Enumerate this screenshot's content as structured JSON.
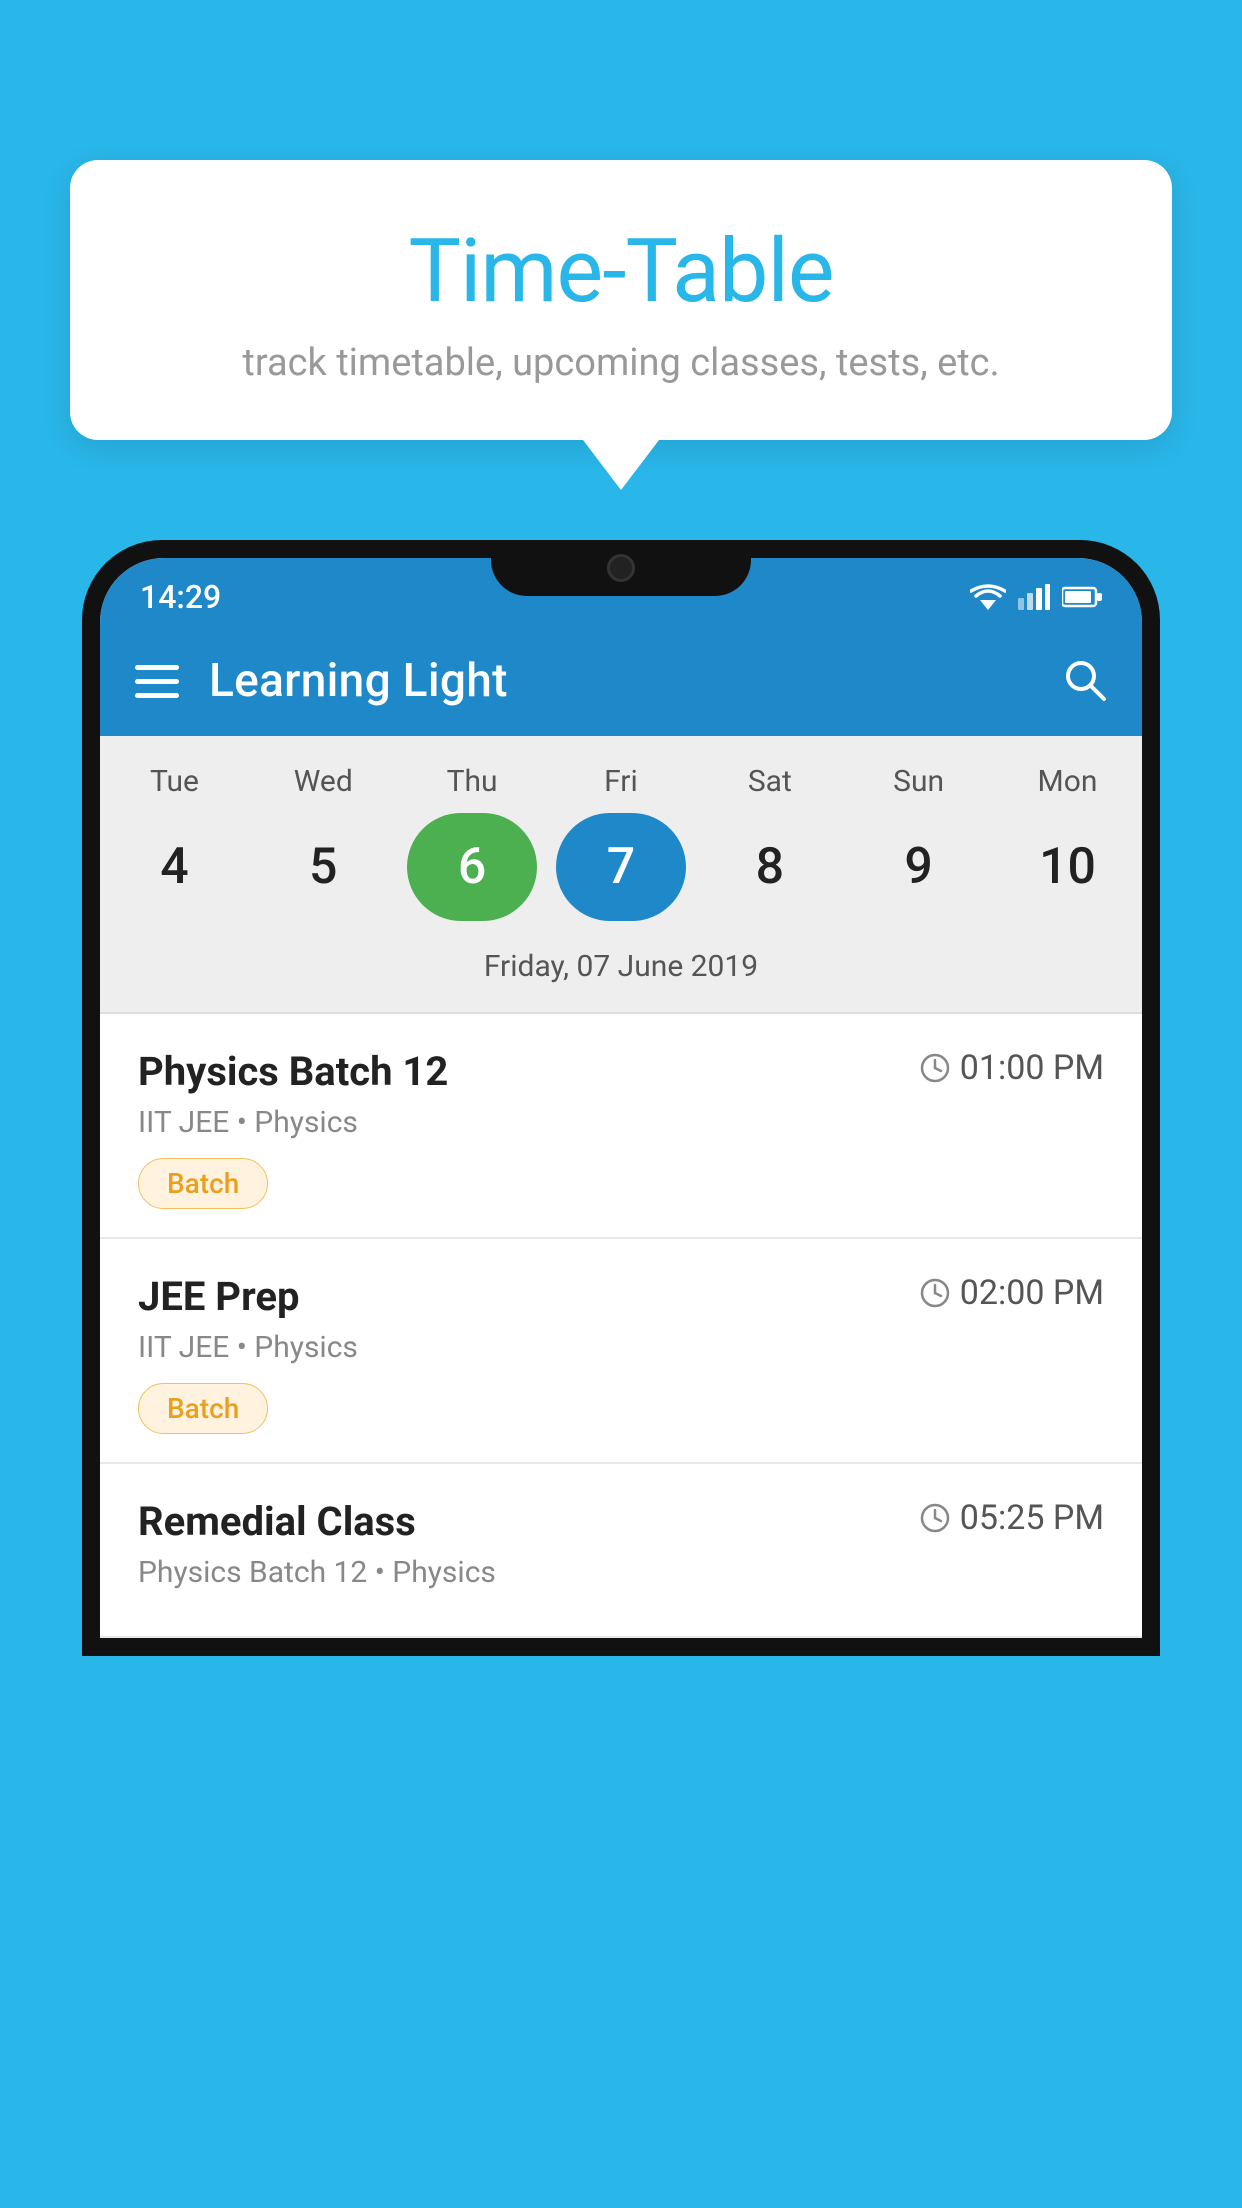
{
  "background_color": "#29b6e8",
  "bubble": {
    "title": "Time-Table",
    "subtitle": "track timetable, upcoming classes, tests, etc."
  },
  "phone": {
    "status_bar": {
      "time": "14:29"
    },
    "app_bar": {
      "title": "Learning Light"
    },
    "calendar": {
      "days": [
        "Tue",
        "Wed",
        "Thu",
        "Fri",
        "Sat",
        "Sun",
        "Mon"
      ],
      "dates": [
        "4",
        "5",
        "6",
        "7",
        "8",
        "9",
        "10"
      ],
      "today_index": 2,
      "selected_index": 3,
      "selected_date_label": "Friday, 07 June 2019"
    },
    "classes": [
      {
        "name": "Physics Batch 12",
        "time": "01:00 PM",
        "meta": "IIT JEE • Physics",
        "tag": "Batch"
      },
      {
        "name": "JEE Prep",
        "time": "02:00 PM",
        "meta": "IIT JEE • Physics",
        "tag": "Batch"
      },
      {
        "name": "Remedial Class",
        "time": "05:25 PM",
        "meta": "Physics Batch 12 • Physics",
        "tag": ""
      }
    ]
  }
}
